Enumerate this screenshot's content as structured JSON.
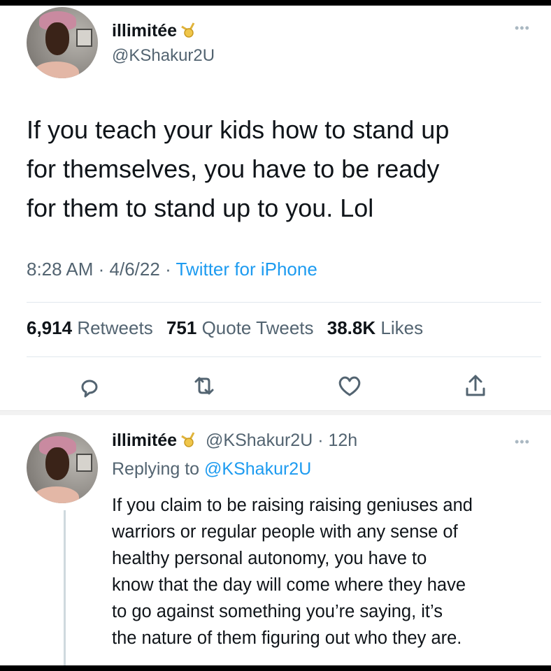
{
  "tweet": {
    "author": {
      "name": "illimitée",
      "handle": "@KShakur2U",
      "badge_icon": "medal-icon"
    },
    "more_icon": "more-icon",
    "text_lines": [
      "If you teach your kids how to stand up",
      "for themselves, you have to be ready",
      "for them to stand up to you. Lol"
    ],
    "time": "8:28 AM",
    "date": "4/6/22",
    "source": "Twitter for iPhone",
    "stats": {
      "retweets": "6,914",
      "retweets_label": "Retweets",
      "quotes": "751",
      "quotes_label": "Quote Tweets",
      "likes": "38.8K",
      "likes_label": "Likes"
    },
    "actions": [
      "reply-icon",
      "retweet-icon",
      "like-icon",
      "share-icon"
    ]
  },
  "reply": {
    "author": {
      "name": "illimitée",
      "handle": "@KShakur2U",
      "age": "12h"
    },
    "replying_prefix": "Replying to",
    "replying_to": "@KShakur2U",
    "text_lines": [
      "If you claim to be raising raising geniuses and",
      "warriors or regular people with any sense of",
      "healthy personal autonomy, you have to",
      "know that the day will come where they have",
      "to go against something you’re saying, it’s",
      "the nature of them figuring out who they are."
    ]
  },
  "colors": {
    "text": "#0f1419",
    "secondary": "#536471",
    "link": "#1d9bf0"
  }
}
